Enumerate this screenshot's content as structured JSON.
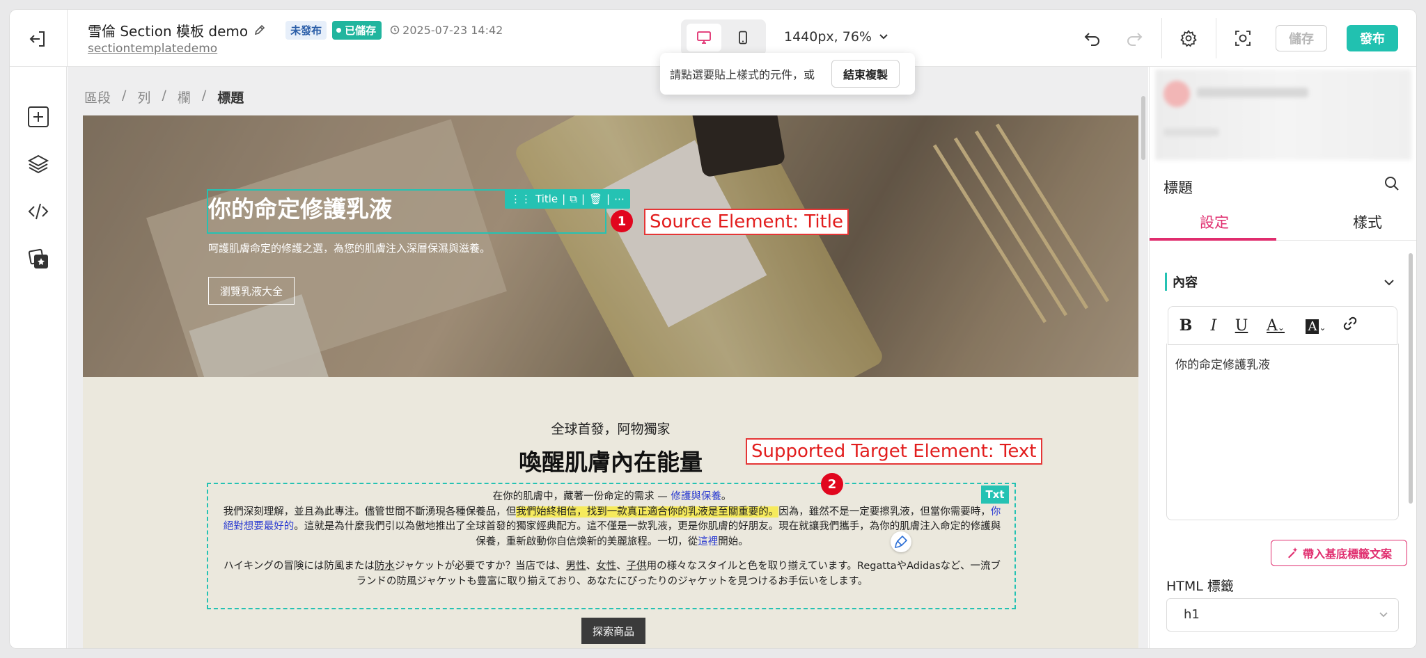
{
  "topbar": {
    "doc_title": "雪倫 Section 模板 demo",
    "slug": "sectiontemplatedemo",
    "badge_unpublished": "未發布",
    "badge_saved": "已儲存",
    "timestamp": "2025-07-23 14:42",
    "viewport_label": "1440px, 76%",
    "save_label": "儲存",
    "publish_label": "發布"
  },
  "popover": {
    "text": "請點選要貼上樣式的元件，或",
    "end_copy_label": "結束複製"
  },
  "breadcrumb": {
    "items": [
      "區段",
      "列",
      "欄"
    ],
    "current": "標題",
    "separator": "/"
  },
  "hero": {
    "title": "你的命定修護乳液",
    "subtitle": "呵護肌膚命定的修護之選，為您的肌膚注入深層保濕與滋養。",
    "button": "瀏覽乳液大全",
    "toolbar_label": "Title"
  },
  "annotations": {
    "marker1": "1",
    "source_label": "Source Element: Title",
    "marker2": "2",
    "target_label": "Supported Target Element: Text"
  },
  "section2": {
    "eyebrow": "全球首發，阿物獨家",
    "title": "喚醒肌膚內在能量",
    "txt_badge": "Txt",
    "para1": {
      "line1_a": "在你的肌膚中，藏著一份命定的需求 — ",
      "line1_link": "修護與保養",
      "line1_b": "。",
      "a": "我們深刻理解，並且為此專注。儘管世間不斷湧現各種保養品，但",
      "highlight": "我們始終相信，找到一款真正適合你的乳液是至關重要的。",
      "b": "因為，雖然不是一定要擦乳液，但當你需要時，",
      "link2": "你絕對想要最好的",
      "c": "。這就是為什麼我們引以為傲地推出了全球首發的獨家經典配方。這不僅是一款乳液，更是你肌膚的好朋友。現在就讓我們攜手，為你的肌膚注入命定的修護與保養，重新啟動你自信煥新的美麗旅程。一切，從",
      "link3": "這裡",
      "d": "開始。"
    },
    "para2": {
      "a": "ハイキングの冒険には防風または",
      "u1": "防水",
      "b": "ジャケットが必要ですか？当店では、",
      "u2": "男性",
      "sep1": "、",
      "u3": "女性",
      "sep2": "、",
      "u4": "子供",
      "c": "用の様々なスタイルと色を取り揃えています。RegattaやAdidasなど、一流ブランドの防風ジャケットも豊富に取り揃えており、あなたにぴったりのジャケットを見つけるお手伝いをします。"
    },
    "button": "探索商品"
  },
  "rightpanel": {
    "title": "標題",
    "tabs": [
      "設定",
      "樣式"
    ],
    "section_label": "內容",
    "editor_content": "你的命定修護乳液",
    "inject_label": "帶入基底標籤文案",
    "html_tag_label": "HTML 標籤",
    "html_tag_value": "h1"
  },
  "colors": {
    "accent": "#25c2b3",
    "pink": "#e02d6e",
    "callout_red": "#e21d1d"
  }
}
